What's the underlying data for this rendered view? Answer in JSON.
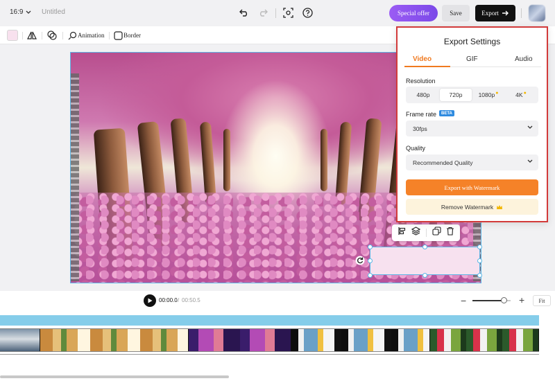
{
  "topbar": {
    "aspect_ratio": "16:9",
    "document_title": "Untitled",
    "special_offer_label": "Special offer",
    "save_label": "Save",
    "export_label": "Export"
  },
  "edit_toolbar": {
    "fill_color": "#f8e1ee",
    "animation_label": "Animation",
    "border_label": "Border"
  },
  "playback": {
    "current_time": "00:00.0",
    "separator": "/",
    "total_time": "00:50.5",
    "zoom_level": 0.82,
    "fit_label": "Fit"
  },
  "export_panel": {
    "title": "Export Settings",
    "tabs": [
      {
        "label": "Video",
        "active": true
      },
      {
        "label": "GIF",
        "active": false
      },
      {
        "label": "Audio",
        "active": false
      }
    ],
    "resolution_label": "Resolution",
    "resolutions": [
      {
        "label": "480p",
        "selected": false,
        "premium": false
      },
      {
        "label": "720p",
        "selected": true,
        "premium": false
      },
      {
        "label": "1080p",
        "selected": false,
        "premium": true
      },
      {
        "label": "4K",
        "selected": false,
        "premium": true
      }
    ],
    "frame_rate_label": "Frame rate",
    "beta_badge": "BETA",
    "frame_rate_value": "30fps",
    "quality_label": "Quality",
    "quality_value": "Recommended Quality",
    "export_watermark_label": "Export with Watermark",
    "remove_watermark_label": "Remove Watermark"
  },
  "colors": {
    "accent_orange": "#f58228",
    "selection_blue": "#5bb6e6",
    "highlight_red": "#d23a3a",
    "offer_purple": "#8b52ee"
  }
}
